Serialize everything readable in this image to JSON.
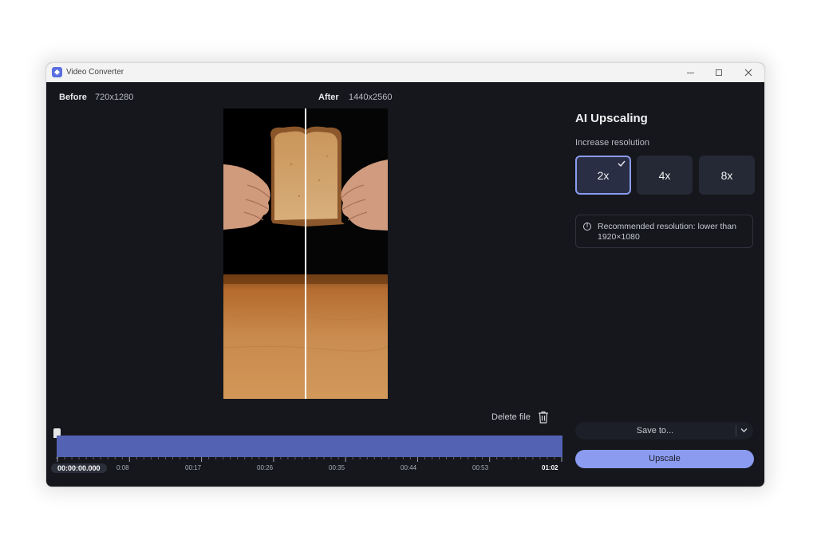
{
  "window": {
    "title": "Video Converter",
    "controls": {
      "minimize": "minimize-icon",
      "maximize": "maximize-icon",
      "close": "close-icon"
    }
  },
  "preview": {
    "before_label": "Before",
    "before_resolution": "720x1280",
    "after_label": "After",
    "after_resolution": "1440x2560"
  },
  "file": {
    "delete_label": "Delete file",
    "delete_icon": "trash-icon"
  },
  "timeline": {
    "current_time": "00:00:00.000",
    "tick_labels": [
      "0:08",
      "00:17",
      "00:26",
      "00:35",
      "00:44",
      "00:53"
    ],
    "end_time": "01:02",
    "position_fraction": 0,
    "track_color": "#5462b3"
  },
  "panel": {
    "title": "AI Upscaling",
    "subtitle": "Increase resolution",
    "scale_options": [
      "2x",
      "4x",
      "8x"
    ],
    "selected_option": "2x",
    "info_text": "Recommended resolution: lower than 1920×1080",
    "save_label": "Save to...",
    "upscale_label": "Upscale",
    "accent_color": "#8b9bf0"
  }
}
